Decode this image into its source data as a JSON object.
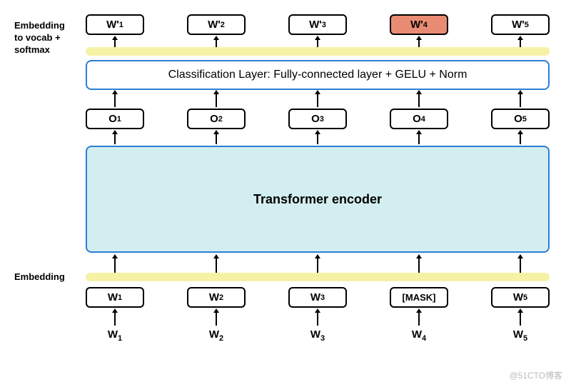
{
  "labels": {
    "embedding_top": "Embedding\nto vocab +\nsoftmax",
    "embedding_bottom": "Embedding",
    "classification_layer": "Classification Layer: Fully-connected layer + GELU + Norm",
    "encoder": "Transformer encoder",
    "watermark": "@51CTO博客"
  },
  "outputs": {
    "items": [
      "W'₁",
      "W'₂",
      "W'₃",
      "W'₄",
      "W'₅"
    ],
    "highlight_index": 3
  },
  "hidden": {
    "items": [
      "O₁",
      "O₂",
      "O₃",
      "O₄",
      "O₅"
    ]
  },
  "embedded_inputs": {
    "items": [
      "W₁",
      "W₂",
      "W₃",
      "[MASK]",
      "W₅"
    ]
  },
  "raw_inputs": {
    "items": [
      "W₁",
      "W₂",
      "W₃",
      "W₄",
      "W₅"
    ]
  }
}
